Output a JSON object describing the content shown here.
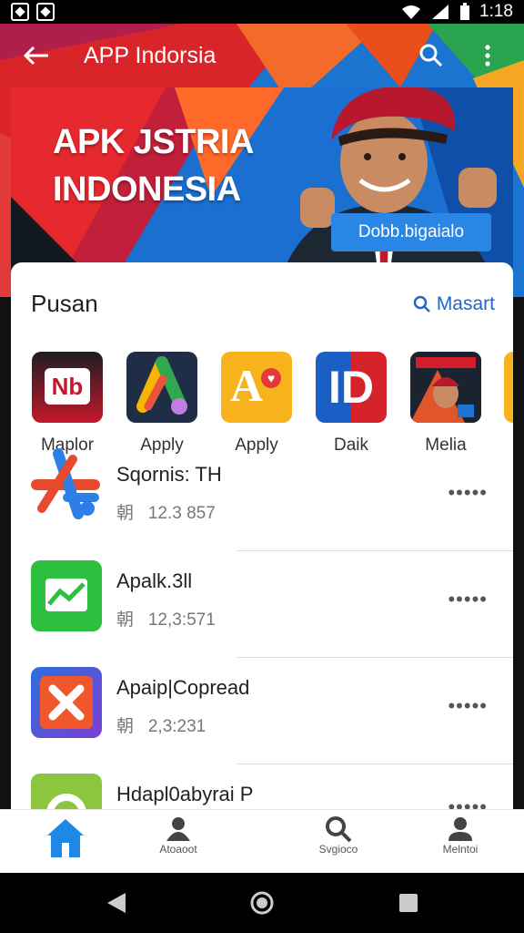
{
  "status_bar": {
    "time": "1:18"
  },
  "app_bar": {
    "title": "APP Indorsia",
    "back_icon": "arrow-left-icon",
    "search_icon": "search-icon",
    "menu_icon": "more-vert-icon"
  },
  "banner": {
    "headline_line1": "APK JSTRIA",
    "headline_line2": "INDONESIA",
    "cta_label": "Dobb.bigaialo"
  },
  "section": {
    "title": "Pusan",
    "see_more_label": "Masart"
  },
  "featured_apps": [
    {
      "name": "Maplor",
      "icon": "nb-app-icon"
    },
    {
      "name": "Apply",
      "icon": "a-triangle-app-icon"
    },
    {
      "name": "Apply",
      "icon": "a-heart-app-icon"
    },
    {
      "name": "Daik",
      "icon": "d-app-icon"
    },
    {
      "name": "Melia",
      "icon": "news-app-icon"
    }
  ],
  "app_list": [
    {
      "title": "Sqornis: TH",
      "meta_prefix": "朝",
      "meta_value": "12.3 857",
      "icon": "star-app-icon"
    },
    {
      "title": "Apalk.3ll",
      "meta_prefix": "朝",
      "meta_value": "12,3:571",
      "icon": "message-app-icon"
    },
    {
      "title": "Apaip|Copread",
      "meta_prefix": "朝",
      "meta_value": "2,3:231",
      "icon": "x-app-icon"
    },
    {
      "title": "Hdapl0abyrai P",
      "meta_prefix": "",
      "meta_value": "",
      "icon": "green-app-icon"
    }
  ],
  "more_label": "•••••",
  "bottom_nav": [
    {
      "label": "",
      "icon": "home-icon",
      "active": true
    },
    {
      "label": "Atoaoot",
      "icon": "users-icon"
    },
    {
      "label": "Svgioco",
      "icon": "search-icon"
    },
    {
      "label": "Melntoi",
      "icon": "person-icon"
    }
  ],
  "colors": {
    "accent": "#1e88e5",
    "link": "#2266c8",
    "banner_red": "#d9252a",
    "banner_blue": "#1b74d0"
  }
}
